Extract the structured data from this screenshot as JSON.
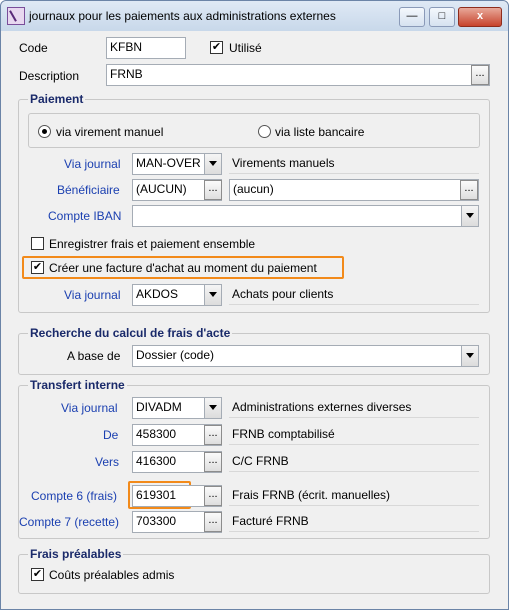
{
  "window": {
    "title": "journaux pour les paiements aux administrations externes",
    "minimize": "—",
    "maximize": "□",
    "close": "x"
  },
  "header": {
    "code_label": "Code",
    "code_value": "KFBN",
    "utilise_label": "Utilisé",
    "utilise_checked": true,
    "description_label": "Description",
    "description_value": "FRNB"
  },
  "paiement": {
    "title": "Paiement",
    "radio1": "via virement manuel",
    "radio1_selected": true,
    "radio2": "via liste bancaire",
    "radio2_selected": false,
    "via_journal_label": "Via journal",
    "via_journal_value": "MAN-OVER",
    "via_journal_desc": "Virements manuels",
    "beneficiaire_label": "Bénéficiaire",
    "beneficiaire_value": "(AUCUN)",
    "beneficiaire_desc": "(aucun)",
    "compte_iban_label": "Compte IBAN",
    "compte_iban_value": "",
    "enregistrer_label": "Enregistrer frais et paiement ensemble",
    "enregistrer_checked": false,
    "creer_label": "Créer une facture d'achat au moment du paiement",
    "creer_checked": true,
    "via_journal2_label": "Via journal",
    "via_journal2_value": "AKDOS",
    "via_journal2_desc": "Achats pour clients"
  },
  "recherche": {
    "title": "Recherche du calcul de frais d'acte",
    "abase_label": "A base de",
    "abase_value": "Dossier (code)"
  },
  "transfert": {
    "title": "Transfert interne",
    "via_journal_label": "Via journal",
    "via_journal_value": "DIVADM",
    "via_journal_desc": "Administrations externes diverses",
    "de_label": "De",
    "de_value": "458300",
    "de_desc": "FRNB comptabilisé",
    "vers_label": "Vers",
    "vers_value": "416300",
    "vers_desc": "C/C FRNB",
    "compte6_label": "Compte 6 (frais)",
    "compte6_value": "619301",
    "compte6_desc": "Frais FRNB (écrit. manuelles)",
    "compte7_label": "Compte 7 (recette)",
    "compte7_value": "703300",
    "compte7_desc": "Facturé FRNB"
  },
  "frais": {
    "title": "Frais préalables",
    "couts_label": "Coûts préalables admis",
    "couts_checked": true
  },
  "glyphs": {
    "ellipsis": "...",
    "check": "✔"
  },
  "colors": {
    "label_blue": "#1a3fb0",
    "highlight_orange": "#f28a1a"
  }
}
